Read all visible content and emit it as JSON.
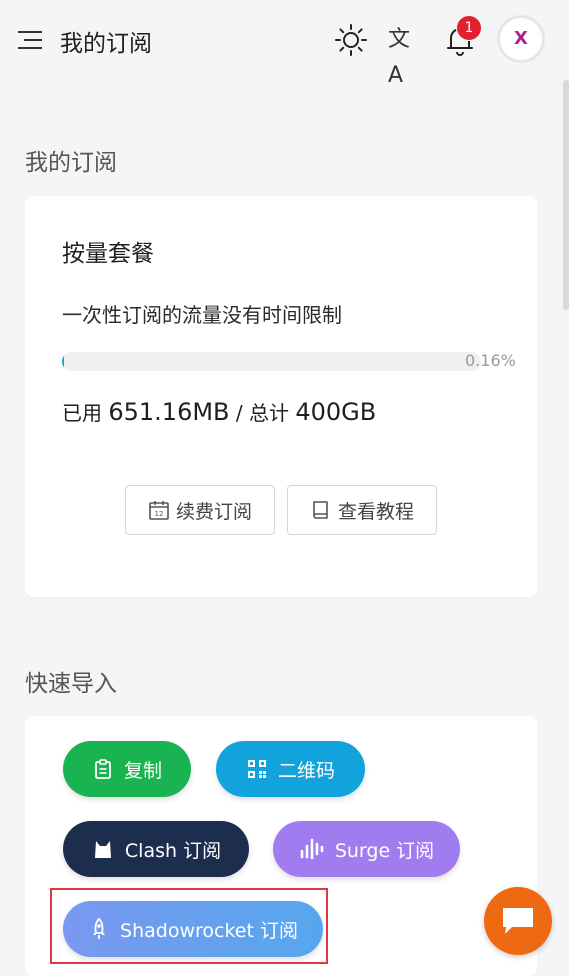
{
  "header": {
    "title": "我的订阅",
    "notification_count": "1",
    "avatar_letter": "X",
    "translate_glyph": "文A"
  },
  "subscription": {
    "section_title": "我的订阅",
    "plan_name": "按量套餐",
    "plan_desc": "一次性订阅的流量没有时间限制",
    "progress_percent_label": "0.16%",
    "progress_value": 0.16,
    "used_label": "已用",
    "used_value": "651.16MB",
    "separator": "/",
    "total_label": "总计",
    "total_value": "400GB",
    "renew_label": "续费订阅",
    "tutorial_label": "查看教程"
  },
  "quick_import": {
    "section_title": "快速导入",
    "copy_label": "复制",
    "qrcode_label": "二维码",
    "clash_label": "Clash 订阅",
    "surge_label": "Surge 订阅",
    "shadowrocket_label": "Shadowrocket 订阅"
  },
  "colors": {
    "accent": "#16a3d8",
    "copy": "#19b351",
    "qrcode": "#12a3dc",
    "clash": "#1d2d4e",
    "surge": "#a07cf0",
    "shadowrocket": "#6aa0ef",
    "badge": "#e5202d",
    "chat_fab": "#ee6a12",
    "highlight": "#e0383d"
  }
}
